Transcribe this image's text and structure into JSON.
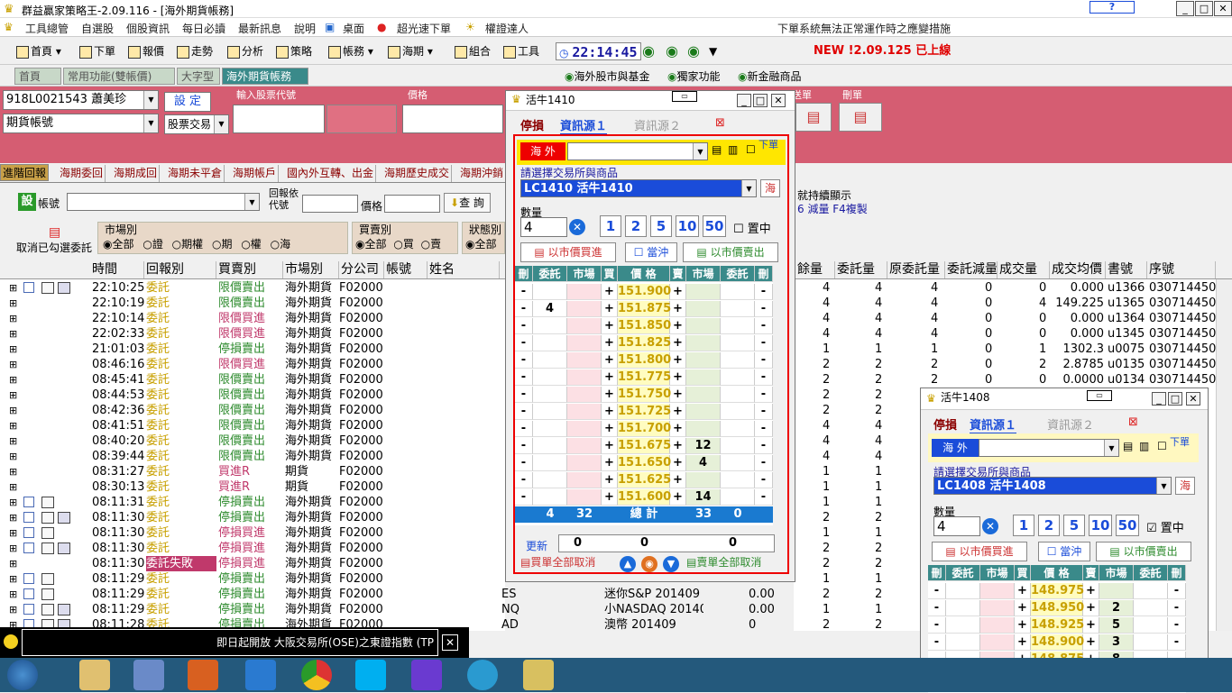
{
  "app": {
    "title": "群益贏家策略王-2.09.116 - [海外期貨帳務]"
  },
  "menu": [
    "工具總管",
    "自選股",
    "個股資訊",
    "每日必讀",
    "最新訊息",
    "說明",
    "桌面",
    "超光速下單",
    "權證達人"
  ],
  "menu_numbers": [
    "1",
    "2",
    "3",
    "4",
    "5",
    "6"
  ],
  "notice": "下單系統無法正常運作時之應變措施",
  "toolbar": {
    "items": [
      "首頁",
      "下單",
      "報價",
      "走勢",
      "分析",
      "策略",
      "帳務",
      "海期",
      "組合",
      "工具"
    ],
    "clock": "22:14:45",
    "new_label": "NEW !2.09.125 已上線"
  },
  "page_tabs": [
    "首頁",
    "常用功能(雙帳價)",
    "大字型",
    "海外期貨帳務"
  ],
  "right_links": [
    "海外股市與基金",
    "獨家功能",
    "新金融商品"
  ],
  "account": {
    "id": "918L0021543 蕭美珍",
    "type": "期貨帳號",
    "setup": "設 定",
    "trade_type": "股票交易"
  },
  "inputs": {
    "code_label": "輸入股票代號",
    "price_label": "價格",
    "send_label": "送單",
    "del_label": "刪單"
  },
  "report_tabs": [
    "進階回報",
    "海期委回",
    "海期成回",
    "海期未平倉",
    "海期帳戶",
    "國內外互轉、出金",
    "海期歷史成交",
    "海期沖銷"
  ],
  "filter": {
    "set": "設",
    "account_label": "帳號",
    "report_code": "回報依代號",
    "price": "價格",
    "query": "查 詢",
    "cancel_checked": "取消已勾選委託",
    "market_label": "市場別",
    "market_opts": [
      "全部",
      "證",
      "期權",
      "期",
      "權",
      "海"
    ],
    "bs_label": "買賣別",
    "bs_opts": [
      "全部",
      "買",
      "賣"
    ],
    "status_label": "狀態別",
    "status_first": "全部",
    "hint1": "就持續顯示",
    "hint2": "6 減量 F4複製"
  },
  "columns": [
    "時間",
    "回報別",
    "買賣別",
    "市場別",
    "分公司",
    "帳號",
    "姓名"
  ],
  "right_columns": [
    "餘量",
    "委託量",
    "原委託量",
    "委託減量",
    "成交量",
    "成交均價",
    "書號",
    "序號"
  ],
  "rows": [
    {
      "t": "22:10:25",
      "r": "委託",
      "bs": "限價賣出",
      "m": "海外期貨",
      "b": "F02000",
      "q": [
        "4",
        "4",
        "4",
        "0",
        "0"
      ],
      "avg": "0.000",
      "bk": "u1366",
      "seq": "030714450",
      "ex": true,
      "c": true,
      "i": 2,
      "col": "s"
    },
    {
      "t": "22:10:19",
      "r": "委託",
      "bs": "限價賣出",
      "m": "海外期貨",
      "b": "F02000",
      "q": [
        "4",
        "4",
        "4",
        "0",
        "4"
      ],
      "avg": "149.225",
      "bk": "u1365",
      "seq": "030714450",
      "ex": false,
      "c": false,
      "i": 0,
      "col": "s"
    },
    {
      "t": "22:10:14",
      "r": "委託",
      "bs": "限價買進",
      "m": "海外期貨",
      "b": "F02000",
      "q": [
        "4",
        "4",
        "4",
        "0",
        "0"
      ],
      "avg": "0.000",
      "bk": "u1364",
      "seq": "030714450",
      "ex": false,
      "c": false,
      "i": 0,
      "col": "b"
    },
    {
      "t": "22:02:33",
      "r": "委託",
      "bs": "限價買進",
      "m": "海外期貨",
      "b": "F02000",
      "q": [
        "4",
        "4",
        "4",
        "0",
        "0"
      ],
      "avg": "0.000",
      "bk": "u1345",
      "seq": "030714450",
      "ex": false,
      "c": false,
      "i": 0,
      "col": "b"
    },
    {
      "t": "21:01:03",
      "r": "委託",
      "bs": "停損賣出",
      "m": "海外期貨",
      "b": "F02000",
      "q": [
        "1",
        "1",
        "1",
        "0",
        "1"
      ],
      "avg": "1302.3",
      "bk": "u0075",
      "seq": "030714450",
      "ex": false,
      "c": false,
      "i": 0,
      "col": "s"
    },
    {
      "t": "08:46:16",
      "r": "委託",
      "bs": "限價買進",
      "m": "海外期貨",
      "b": "F02000",
      "q": [
        "2",
        "2",
        "2",
        "0",
        "2"
      ],
      "avg": "2.8785",
      "bk": "u0135",
      "seq": "030714450",
      "ex": false,
      "c": false,
      "i": 0,
      "col": "b"
    },
    {
      "t": "08:45:41",
      "r": "委託",
      "bs": "限價賣出",
      "m": "海外期貨",
      "b": "F02000",
      "q": [
        "2",
        "2",
        "2",
        "0",
        "0"
      ],
      "avg": "0.0000",
      "bk": "u0134",
      "seq": "030714450",
      "ex": false,
      "c": false,
      "i": 0,
      "col": "s"
    },
    {
      "t": "08:44:53",
      "r": "委託",
      "bs": "限價賣出",
      "m": "海外期貨",
      "b": "F02000",
      "q": [
        "2",
        "2",
        "",
        "",
        ""
      ],
      "avg": "",
      "bk": "",
      "seq": "",
      "ex": false,
      "c": false,
      "i": 0,
      "col": "s"
    },
    {
      "t": "08:42:36",
      "r": "委託",
      "bs": "限價賣出",
      "m": "海外期貨",
      "b": "F02000",
      "q": [
        "2",
        "2",
        "",
        "",
        ""
      ],
      "avg": "",
      "bk": "",
      "seq": "",
      "ex": false,
      "c": false,
      "i": 0,
      "col": "s"
    },
    {
      "t": "08:41:51",
      "r": "委託",
      "bs": "限價賣出",
      "m": "海外期貨",
      "b": "F02000",
      "q": [
        "4",
        "4",
        "",
        "",
        ""
      ],
      "avg": "",
      "bk": "",
      "seq": "",
      "ex": false,
      "c": false,
      "i": 0,
      "col": "s"
    },
    {
      "t": "08:40:20",
      "r": "委託",
      "bs": "限價賣出",
      "m": "海外期貨",
      "b": "F02000",
      "q": [
        "4",
        "4",
        "",
        "",
        ""
      ],
      "avg": "",
      "bk": "",
      "seq": "",
      "ex": false,
      "c": false,
      "i": 0,
      "col": "s"
    },
    {
      "t": "08:39:44",
      "r": "委託",
      "bs": "限價賣出",
      "m": "海外期貨",
      "b": "F02000",
      "q": [
        "4",
        "4",
        "",
        "",
        ""
      ],
      "avg": "",
      "bk": "",
      "seq": "",
      "ex": false,
      "c": false,
      "i": 0,
      "col": "s"
    },
    {
      "t": "08:31:27",
      "r": "委託",
      "bs": "買進R",
      "m": "期貨",
      "b": "F02000",
      "q": [
        "1",
        "1",
        "",
        "",
        ""
      ],
      "avg": "",
      "bk": "",
      "seq": "",
      "ex": false,
      "c": false,
      "i": 0,
      "col": "b"
    },
    {
      "t": "08:30:13",
      "r": "委託",
      "bs": "買進R",
      "m": "期貨",
      "b": "F02000",
      "q": [
        "1",
        "1",
        "",
        "",
        ""
      ],
      "avg": "",
      "bk": "",
      "seq": "",
      "ex": false,
      "c": false,
      "i": 0,
      "col": "b"
    },
    {
      "t": "08:11:31",
      "r": "委託",
      "bs": "停損賣出",
      "m": "海外期貨",
      "b": "F02000",
      "q": [
        "1",
        "1",
        "",
        "",
        ""
      ],
      "avg": "",
      "bk": "",
      "seq": "",
      "ex": true,
      "c": true,
      "i": 1,
      "col": "s"
    },
    {
      "t": "08:11:30",
      "r": "委託",
      "bs": "停損賣出",
      "m": "海外期貨",
      "b": "F02000",
      "q": [
        "2",
        "2",
        "",
        "",
        ""
      ],
      "avg": "",
      "bk": "",
      "seq": "",
      "ex": true,
      "c": true,
      "i": 2,
      "col": "s"
    },
    {
      "t": "08:11:30",
      "r": "委託",
      "bs": "停損買進",
      "m": "海外期貨",
      "b": "F02000",
      "q": [
        "1",
        "1",
        "",
        "",
        ""
      ],
      "avg": "",
      "bk": "",
      "seq": "",
      "ex": true,
      "c": true,
      "i": 1,
      "col": "b"
    },
    {
      "t": "08:11:30",
      "r": "委託",
      "bs": "停損買進",
      "m": "海外期貨",
      "b": "F02000",
      "q": [
        "2",
        "2",
        "",
        "",
        ""
      ],
      "avg": "",
      "bk": "",
      "seq": "",
      "ex": true,
      "c": true,
      "i": 2,
      "col": "b"
    },
    {
      "t": "08:11:30",
      "r": "委託失敗",
      "bs": "停損買進",
      "m": "海外期貨",
      "b": "F02000",
      "q": [
        "2",
        "2",
        "",
        "",
        ""
      ],
      "avg": "",
      "bk": "",
      "seq": "",
      "ex": true,
      "c": false,
      "i": 0,
      "col": "b",
      "fail": true
    },
    {
      "t": "08:11:29",
      "r": "委託",
      "bs": "停損賣出",
      "m": "海外期貨",
      "b": "F02000",
      "q": [
        "1",
        "1",
        "",
        "",
        ""
      ],
      "avg": "",
      "bk": "",
      "seq": "",
      "ex": true,
      "c": true,
      "i": 1,
      "col": "s"
    },
    {
      "t": "08:11:29",
      "r": "委託",
      "bs": "停損賣出",
      "m": "海外期貨",
      "b": "F02000",
      "q": [
        "2",
        "2",
        "",
        "",
        ""
      ],
      "avg": "",
      "bk": "",
      "seq": "",
      "ex": true,
      "c": true,
      "i": 1,
      "col": "s",
      "mid": [
        "ES",
        "迷你S&P 201409",
        "0.00"
      ]
    },
    {
      "t": "08:11:29",
      "r": "委託",
      "bs": "停損賣出",
      "m": "海外期貨",
      "b": "F02000",
      "q": [
        "1",
        "1",
        "",
        "",
        ""
      ],
      "avg": "",
      "bk": "",
      "seq": "",
      "ex": true,
      "c": true,
      "i": 2,
      "col": "s",
      "mid": [
        "NQ",
        "小NASDAQ 20140",
        "0.00"
      ]
    },
    {
      "t": "08:11:28",
      "r": "委託",
      "bs": "停損賣出",
      "m": "海外期貨",
      "b": "F02000",
      "q": [
        "2",
        "2",
        "",
        "",
        ""
      ],
      "avg": "",
      "bk": "",
      "seq": "",
      "ex": true,
      "c": true,
      "i": 2,
      "col": "s",
      "mid": [
        "AD",
        "澳幣 201409",
        "0"
      ]
    }
  ],
  "ticker": "即日起開放 大阪交易所(OSE)之東證指數 (TP",
  "dlg1": {
    "title": "活牛1410",
    "stop": "停損",
    "src1": "資訊源１",
    "src2": "資訊源２",
    "region": "海 外",
    "place_order": "下單",
    "exchange_label": "請選擇交易所與商品",
    "product": "LC1410 活牛1410",
    "qty_label": "數量",
    "qty": "4",
    "qtys": [
      "1",
      "2",
      "5",
      "10",
      "50"
    ],
    "center": "置中",
    "mkt_buy": "以市價買進",
    "daytrade": "當沖",
    "mkt_sell": "以市價賣出",
    "head": [
      "刪",
      "委託",
      "市場",
      "買",
      "價 格",
      "賣",
      "市場",
      "委託",
      "刪"
    ],
    "book": [
      [
        "",
        "",
        "151.900",
        ""
      ],
      [
        "4",
        "",
        "151.875",
        ""
      ],
      [
        "",
        "",
        "151.850",
        ""
      ],
      [
        "",
        "",
        "151.825",
        ""
      ],
      [
        "",
        "",
        "151.800",
        ""
      ],
      [
        "",
        "",
        "151.775",
        ""
      ],
      [
        "",
        "",
        "151.750",
        ""
      ],
      [
        "",
        "",
        "151.725",
        ""
      ],
      [
        "",
        "",
        "151.700",
        ""
      ],
      [
        "",
        "",
        "151.675",
        "12"
      ],
      [
        "",
        "",
        "151.650",
        "4"
      ],
      [
        "",
        "",
        "151.625",
        ""
      ],
      [
        "",
        "",
        "151.600",
        "14"
      ]
    ],
    "total": {
      "bo": "4",
      "bm": "32",
      "label": "總 計",
      "sm": "33",
      "so": "0"
    },
    "refresh": "更新",
    "r_vals": [
      "0",
      "0",
      "0"
    ],
    "buy_cancel": "買單全部取消",
    "sell_cancel": "賣單全部取消"
  },
  "dlg2": {
    "title": "活牛1408",
    "product": "LC1408 活牛1408",
    "qty": "4",
    "book": [
      [
        "",
        "",
        "148.975",
        ""
      ],
      [
        "",
        "",
        "148.950",
        "2"
      ],
      [
        "",
        "",
        "148.925",
        "5"
      ],
      [
        "",
        "",
        "148.900",
        "3"
      ],
      [
        "",
        "",
        "148.875",
        "8"
      ],
      [
        "",
        "",
        "148.850",
        "1"
      ]
    ]
  },
  "colors": {
    "pink": "#d55d72",
    "buy": "#c0396b",
    "sell": "#2e8b2e",
    "price": "#c8a000"
  }
}
